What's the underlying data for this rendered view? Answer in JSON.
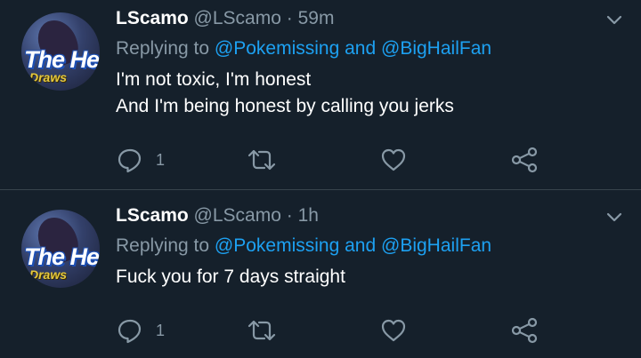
{
  "tweets": [
    {
      "display_name": "LScamo",
      "handle": "@LScamo",
      "separator": "·",
      "time": "59m",
      "reply_prefix": "Replying to",
      "mention_1": "@Pokemissing",
      "reply_and": "and",
      "mention_2": "@BigHailFan",
      "lines": [
        "I'm not toxic, I'm honest",
        "And I'm being honest by calling you jerks"
      ],
      "reply_count": "1",
      "avatar_text_main": "The He",
      "avatar_text_sub": "Draws"
    },
    {
      "display_name": "LScamo",
      "handle": "@LScamo",
      "separator": "·",
      "time": "1h",
      "reply_prefix": "Replying to",
      "mention_1": "@Pokemissing",
      "reply_and": "and",
      "mention_2": "@BigHailFan",
      "lines": [
        "Fuck you for 7 days straight"
      ],
      "reply_count": "1",
      "avatar_text_main": "The He",
      "avatar_text_sub": "Draws"
    }
  ],
  "icons": {
    "reply": "reply-icon",
    "retweet": "retweet-icon",
    "like": "heart-icon",
    "share": "share-icon",
    "menu": "chevron-down-icon"
  },
  "colors": {
    "background": "#15202b",
    "text": "#ffffff",
    "muted": "#8899a6",
    "link": "#1da1f2",
    "divider": "#38444d"
  }
}
